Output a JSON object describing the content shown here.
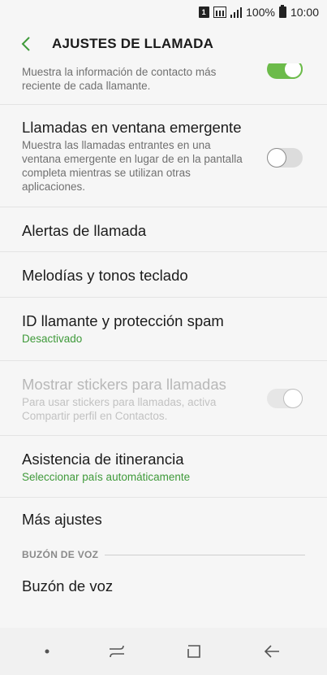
{
  "status_bar": {
    "sim_label": "1",
    "battery_percent": "100%",
    "time": "10:00"
  },
  "header": {
    "title": "AJUSTES DE LLAMADA"
  },
  "settings": [
    {
      "title": "",
      "subtitle": "Muestra la información de contacto más reciente de cada llamante.",
      "toggle": "on"
    },
    {
      "title": "Llamadas en ventana emergente",
      "subtitle": "Muestra las llamadas entrantes en una ventana emergente en lugar de en la pantalla completa mientras se utilizan otras aplicaciones.",
      "toggle": "off"
    },
    {
      "title": "Alertas de llamada"
    },
    {
      "title": "Melodías y tonos teclado"
    },
    {
      "title": "ID llamante y protección spam",
      "subtitle": "Desactivado"
    },
    {
      "title": "Mostrar stickers para llamadas",
      "subtitle": "Para usar stickers para llamadas, activa Compartir perfil en Contactos.",
      "toggle": "on-disabled"
    },
    {
      "title": "Asistencia de itinerancia",
      "subtitle": "Seleccionar país automáticamente"
    },
    {
      "title": "Más ajustes"
    }
  ],
  "voicemail_section": {
    "header": "BUZÓN DE VOZ",
    "item": "Buzón de voz"
  },
  "colors": {
    "accent": "#6cbb4a",
    "summary_green": "#3f9a3a",
    "background": "#f6f6f6"
  },
  "icons": {
    "back": "chevron-left-icon",
    "recents": "recents-icon",
    "home": "home-icon",
    "nav_back": "back-arrow-icon"
  }
}
